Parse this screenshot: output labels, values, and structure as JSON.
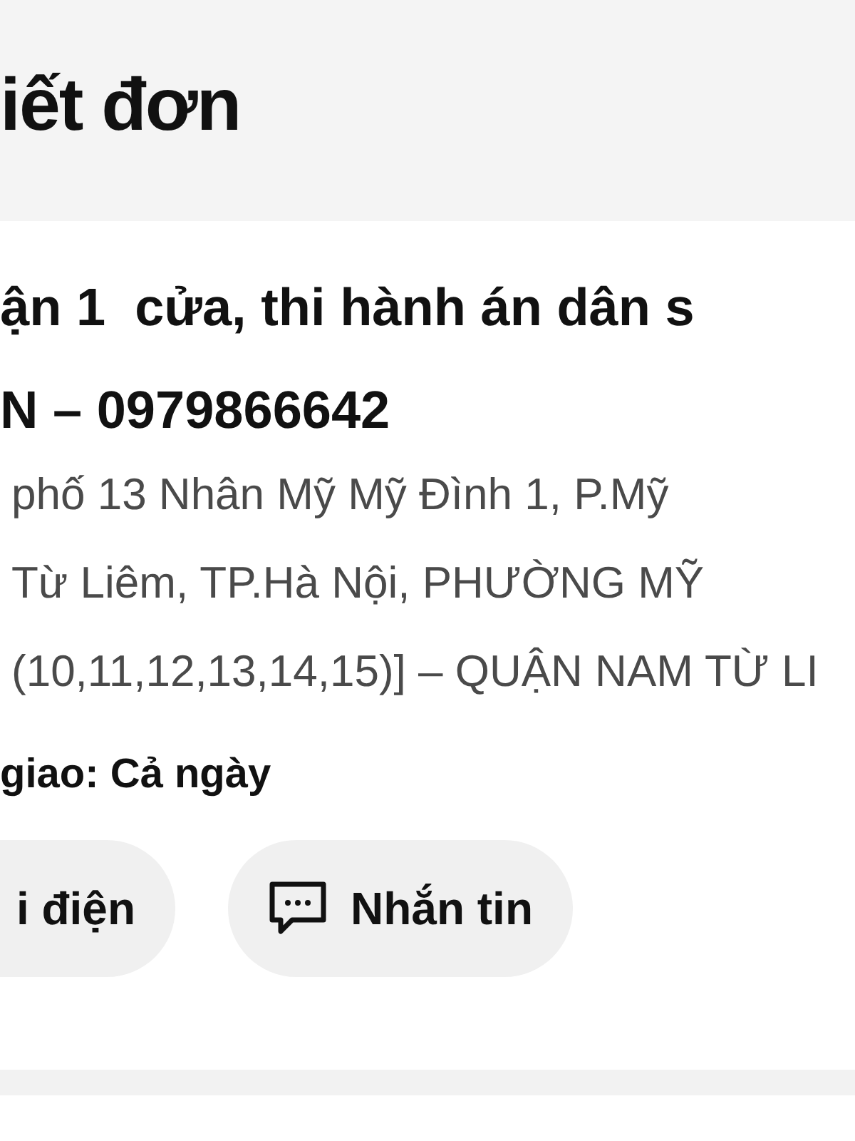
{
  "header": {
    "title": "iết đơn"
  },
  "order": {
    "recipient": "ận 1  cửa, thi hành án dân s",
    "phone": "N – 0979866642",
    "address_lines": [
      "phố 13 Nhân Mỹ Mỹ Đình 1, P.Mỹ",
      "Từ Liêm, TP.Hà Nội, PHƯỜNG MỸ",
      "(10,11,12,13,14,15)] – QUẬN NAM TỪ LI"
    ],
    "delivery_time": "giao: Cả ngày",
    "actions": [
      {
        "kind": "call",
        "label": "i điện"
      },
      {
        "kind": "message",
        "label": "Nhắn tin"
      }
    ]
  }
}
